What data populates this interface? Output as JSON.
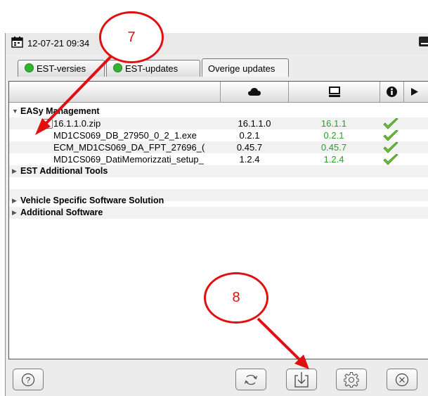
{
  "titlebar": {
    "timestamp": "12-07-21 09:34"
  },
  "tabs": [
    {
      "label": "EST-versies",
      "status_color": "#2fb52f"
    },
    {
      "label": "EST-updates",
      "status_color": "#2fb52f"
    },
    {
      "label": "Overige updates"
    }
  ],
  "columns": {
    "col1_icon": "cloud-icon",
    "col2_icon": "computer-icon",
    "col3_icon": "info-icon",
    "col4_icon": "play-icon"
  },
  "tree": {
    "group1": {
      "label": "EASy Management"
    },
    "items": [
      {
        "name": "16.1.1.0.zip",
        "cloud_version": "16.1.1.0",
        "local_version": "16.1.1",
        "status": "check-icon"
      },
      {
        "name": "MD1CS069_DB_27950_0_2_1.exe",
        "cloud_version": "0.2.1",
        "local_version": "0.2.1",
        "status": "check-icon"
      },
      {
        "name": "ECM_MD1CS069_DA_FPT_27696_(",
        "cloud_version": "0.45.7",
        "local_version": "0.45.7",
        "status": "check-icon"
      },
      {
        "name": "MD1CS069_DatiMemorizzati_setup_",
        "cloud_version": "1.2.4",
        "local_version": "1.2.4",
        "status": "check-icon"
      }
    ],
    "group2": {
      "label": "EST Additional Tools"
    },
    "group3": {
      "label": "Vehicle Specific Software Solution"
    },
    "group4": {
      "label": "Additional Software"
    }
  },
  "toolbar": {
    "help": "help-icon",
    "refresh": "refresh-icon",
    "download": "download-icon",
    "settings": "gear-icon",
    "close": "close-icon"
  },
  "annotations": {
    "a7": "7",
    "a8": "8",
    "color": "#e01010"
  }
}
